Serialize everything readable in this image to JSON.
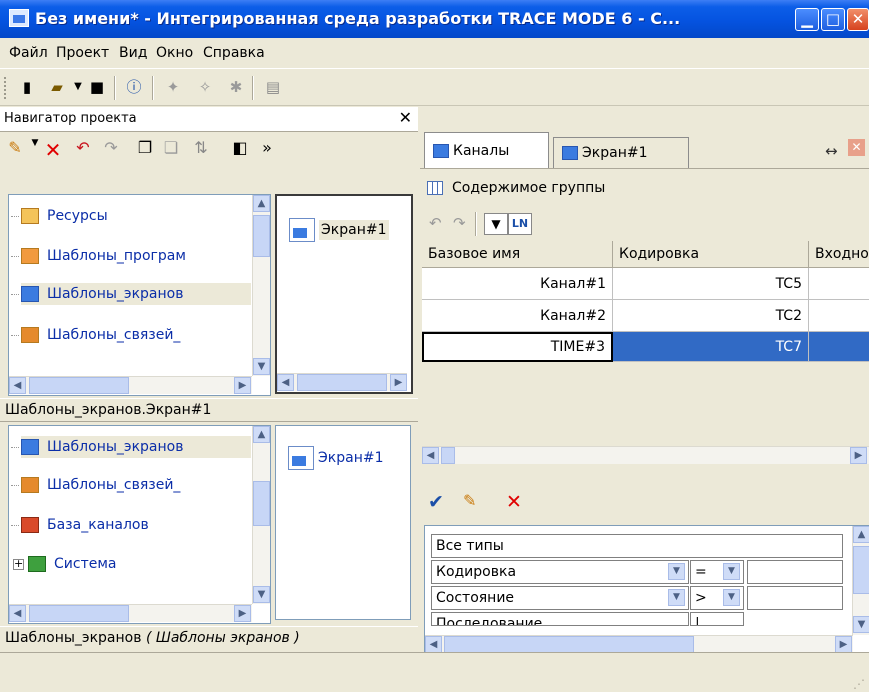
{
  "window": {
    "title": "Без имени* - Интегрированная среда разработки TRACE MODE 6 - С...",
    "min_glyph": "▁",
    "max_glyph": "□",
    "close_glyph": "✕"
  },
  "menu": [
    "Файл",
    "Проект",
    "Вид",
    "Окно",
    "Справка"
  ],
  "navigator": {
    "title": "Навигатор проекта",
    "close_glyph": "✕",
    "more_glyph": "»",
    "top_tree": [
      "Ресурсы",
      "Шаблоны_програм",
      "Шаблоны_экранов",
      "Шаблоны_связей_"
    ],
    "top_list": [
      "Экран#1"
    ],
    "path_label": "Шаблоны_экранов.Экран#1",
    "bottom_tree": [
      "Шаблоны_экранов",
      "Шаблоны_связей_",
      "База_каналов",
      "Система"
    ],
    "bottom_list": [
      "Экран#1"
    ],
    "status_label": "Шаблоны_экранов",
    "status_italic": "( Шаблоны экранов )"
  },
  "tabs": [
    "Каналы",
    "Экран#1"
  ],
  "group": {
    "title": "Содержимое группы",
    "filter_btn": "LN"
  },
  "grid": {
    "columns": [
      "Базовое имя",
      "Кодировка",
      "Входно"
    ],
    "rows": [
      {
        "name": "Канал#1",
        "code": "TC5"
      },
      {
        "name": "Канал#2",
        "code": "TC2"
      },
      {
        "name": "TIME#3",
        "code": "TC7"
      }
    ]
  },
  "filters": [
    {
      "label": "Все типы",
      "op": ""
    },
    {
      "label": "Кодировка",
      "op": "="
    },
    {
      "label": "Состояние",
      "op": ">"
    },
    {
      "label": "Последование",
      "op": "|"
    }
  ],
  "colors": {
    "titlebar": "#0553e0",
    "selection": "#316ac5",
    "link_text": "#0b2ea8"
  }
}
